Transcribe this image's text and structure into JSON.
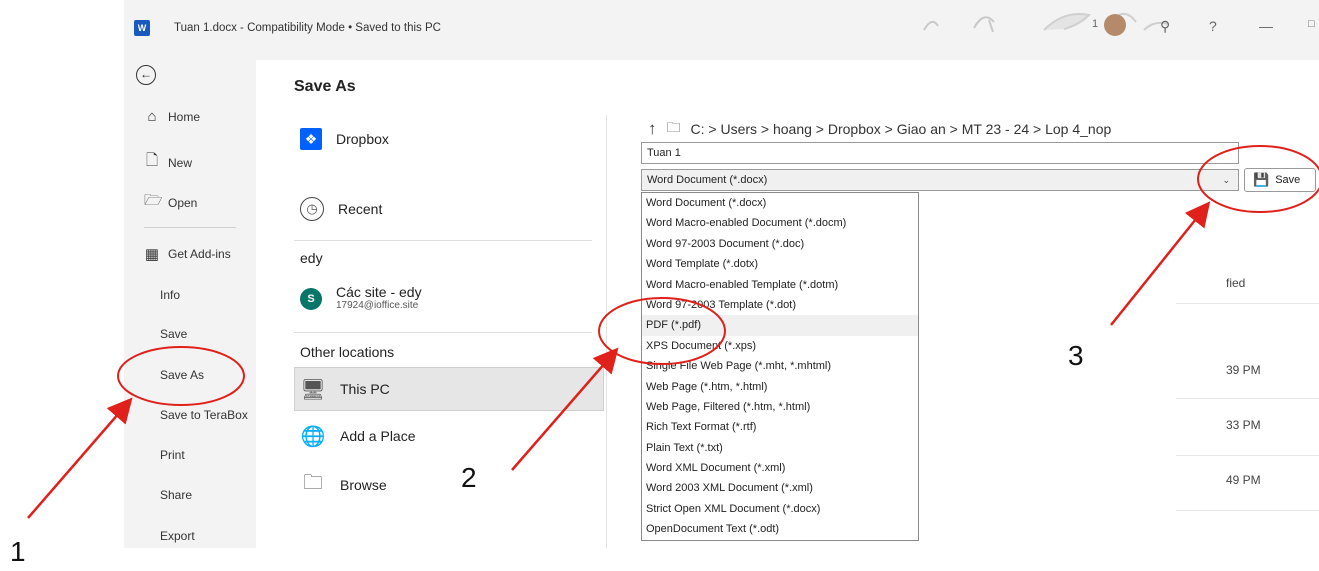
{
  "window": {
    "app_icon": "word-icon",
    "app_icon_text": "W",
    "title": "Tuan 1.docx  -  Compatibility Mode • Saved to this PC",
    "account_initial": "1",
    "help": "?",
    "minimize": "—"
  },
  "sidebar": {
    "items": [
      {
        "label": "Home",
        "icon": "home-icon"
      },
      {
        "label": "New",
        "icon": "new-doc-icon"
      },
      {
        "label": "Open",
        "icon": "folder-open-icon"
      },
      {
        "label": "Get Add-ins",
        "icon": "addins-icon"
      },
      {
        "label": "Info"
      },
      {
        "label": "Save"
      },
      {
        "label": "Save As"
      },
      {
        "label": "Save to TeraBox"
      },
      {
        "label": "Print"
      },
      {
        "label": "Share"
      },
      {
        "label": "Export"
      }
    ]
  },
  "main": {
    "title": "Save As",
    "locations": {
      "dropbox": "Dropbox",
      "recent": "Recent",
      "section_edy": "edy",
      "cac_site_name": "Các site - edy",
      "cac_site_email": "17924@ioffice.site",
      "section_other": "Other locations",
      "this_pc": "This PC",
      "add_place": "Add a Place",
      "browse": "Browse"
    },
    "path": "C: > Users > hoang > Dropbox > Giao an > MT 23 - 24 > Lop 4_nop",
    "filename": "Tuan 1",
    "file_type_selected": "Word Document (*.docx)",
    "save_label": "Save",
    "file_types": [
      "Word Document (*.docx)",
      "Word Macro-enabled Document (*.docm)",
      "Word 97-2003 Document (*.doc)",
      "Word Template (*.dotx)",
      "Word Macro-enabled Template (*.dotm)",
      "Word 97-2003 Template (*.dot)",
      "PDF (*.pdf)",
      "XPS Document (*.xps)",
      "Single File Web Page (*.mht, *.mhtml)",
      "Web Page (*.htm, *.html)",
      "Web Page, Filtered (*.htm, *.html)",
      "Rich Text Format (*.rtf)",
      "Plain Text (*.txt)",
      "Word XML Document (*.xml)",
      "Word 2003 XML Document (*.xml)",
      "Strict Open XML Document (*.docx)",
      "OpenDocument Text (*.odt)"
    ],
    "list_header_fragment": "fied",
    "list_times": [
      "39 PM",
      "33 PM",
      "49 PM"
    ]
  },
  "annotations": {
    "step1": "1",
    "step2": "2",
    "step3": "3",
    "color": "#e0201b"
  }
}
